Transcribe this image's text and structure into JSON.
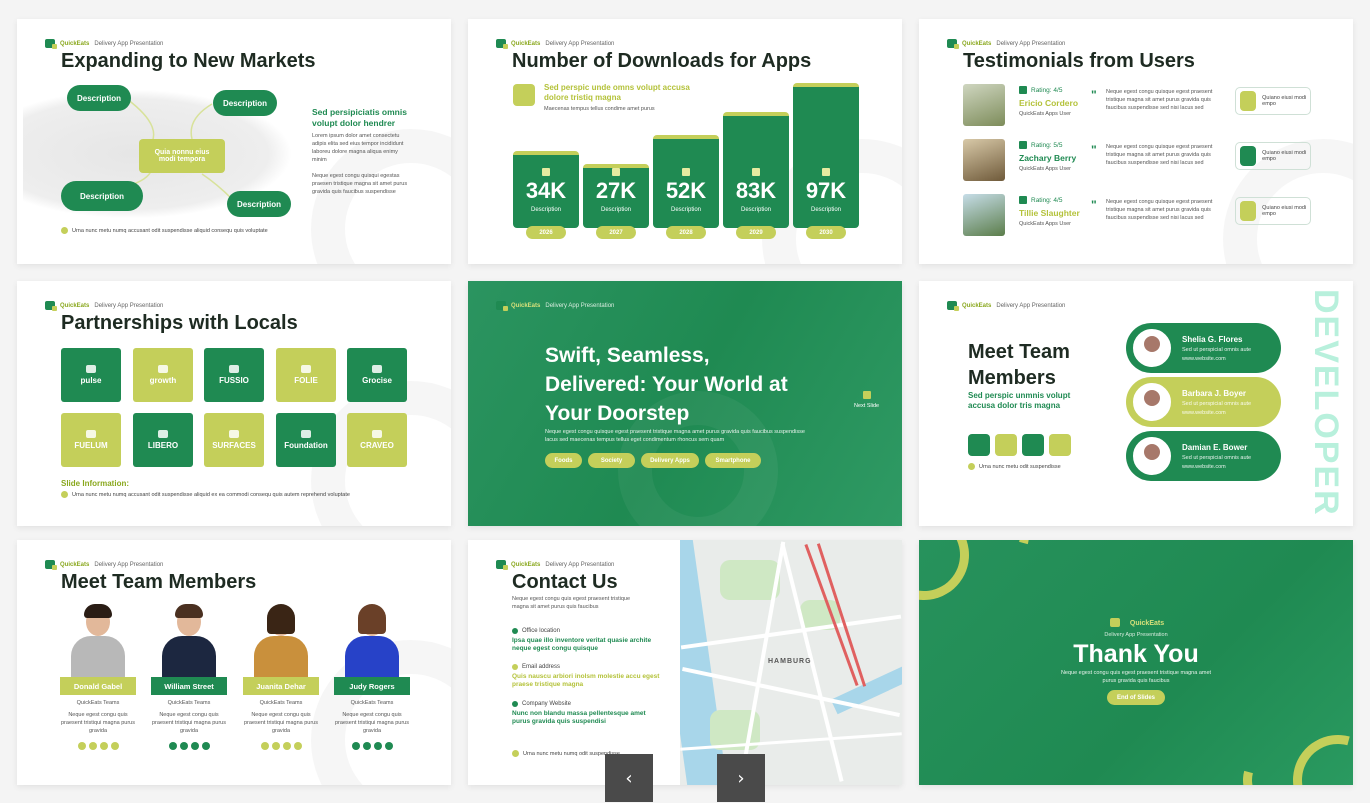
{
  "brand": {
    "name": "QuickEats",
    "subtitle": "Delivery App Presentation"
  },
  "slide1": {
    "title": "Expanding to New Markets",
    "pills": [
      "Description",
      "Description",
      "Quia nonnu eius modi tempora",
      "Description",
      "Description"
    ],
    "side_heading": "Sed persipiciatis omnis volupt dolor hendrer",
    "side_text1": "Lorem ipsum dolor amet consectetu adipis elita sed eius tempor incididunt laboreu dolore magna aliqua enimy minim",
    "side_text2": "Neque egest congu quisqui egestas praesen tristique magna sit amet purus gravida quis faucibus suspendisse",
    "footer": "Urna nunc metu numq accusant odit suspendisse aliquid consequ quis voluptate"
  },
  "slide2": {
    "title": "Number of Downloads for Apps",
    "subhead": "Sed perspic unde omns volupt accusa dolore tristiq magna",
    "subtext": "Maecenas tempus tellus condime amet purus",
    "bars": [
      {
        "value": "34K",
        "label": "Description",
        "year": "2026",
        "level": 0.53
      },
      {
        "value": "27K",
        "label": "Description",
        "year": "2027",
        "level": 0.44
      },
      {
        "value": "52K",
        "label": "Description",
        "year": "2028",
        "level": 0.64
      },
      {
        "value": "83K",
        "label": "Description",
        "year": "2029",
        "level": 0.8
      },
      {
        "value": "97K",
        "label": "Description",
        "year": "2030",
        "level": 1.0
      }
    ]
  },
  "slide3": {
    "title": "Testimonials from Users",
    "users": [
      {
        "rating": "Rating: 4/5",
        "name": "Ericio Cordero",
        "role": "QuickEats Apps User",
        "quote": "Neque egest congu quisque egest praesent tristique magna sit amet purus gravida quis faucibus suspendisse sed nisi lacus sed",
        "button": "Quiano eiusi modi empo"
      },
      {
        "rating": "Rating: 5/5",
        "name": "Zachary Berry",
        "role": "QuickEats Apps User",
        "quote": "Neque egest congu quisque egest praesent tristique magna sit amet purus gravida quis faucibus suspendisse sed nisi lacus sed",
        "button": "Quiano eiusi modi empo"
      },
      {
        "rating": "Rating: 4/5",
        "name": "Tillie Slaughter",
        "role": "QuickEats Apps User",
        "quote": "Neque egest congu quisque egest praesent tristique magna sit amet purus gravida quis faucibus suspendisse sed nisi lacus sed",
        "button": "Quiano eiusi modi empo"
      }
    ]
  },
  "slide4": {
    "title": "Partnerships with Locals",
    "partners": [
      "pulse",
      "growth",
      "FUSSIO",
      "FOLIE",
      "Grocise",
      "FUELUM",
      "LIBERO",
      "SURFACES",
      "Foundation",
      "CRAVEO"
    ],
    "info_label": "Slide Information:",
    "footer": "Urna nunc metu numq accusant odit suspendisse aliquid ex ea commodi consequ quis autem reprehend voluptate"
  },
  "slide5": {
    "title": "Swift, Seamless, Delivered: Your World at Your Doorstep",
    "desc": "Neque egest congu quisque egest praesent tristique magna amet purus gravida quis faucibus suspendisse lacus sed maecenas tempus tellus eget condimentum rhoncus sem quam",
    "tags": [
      "Foods",
      "Society",
      "Delivery Apps",
      "Smartphone"
    ],
    "next": "Next Slide"
  },
  "slide6": {
    "title": "Meet Team Members",
    "subhead": "Sed perspic unmnis volupt accusa dolor tris magna",
    "footer": "Urna nunc metu odit suspendisse",
    "vertical": "DEVELOPER",
    "members": [
      {
        "name": "Shelia G. Flores",
        "sub": "Sed ut perspicial omnis aute",
        "web": "www.website.com"
      },
      {
        "name": "Barbara J. Boyer",
        "sub": "Sed ut perspicial omnis aute",
        "web": "www.website.com"
      },
      {
        "name": "Damian E. Bower",
        "sub": "Sed ut perspicial omnis aute",
        "web": "www.website.com"
      }
    ]
  },
  "slide7": {
    "title": "Meet Team Members",
    "people": [
      {
        "name": "Donald Gabel",
        "role": "QuickEats Teams",
        "desc": "Neque egest congu quis praesent tristiqui magna purus gravida"
      },
      {
        "name": "William Street",
        "role": "QuickEats Teams",
        "desc": "Neque egest congu quis praesent tristiqui magna purus gravida"
      },
      {
        "name": "Juanita Dehar",
        "role": "QuickEats Teams",
        "desc": "Neque egest congu quis praesent tristiqui magna purus gravida"
      },
      {
        "name": "Judy Rogers",
        "role": "QuickEats Teams",
        "desc": "Neque egest congu quis praesent tristiqui magna purus gravida"
      }
    ]
  },
  "slide8": {
    "title": "Contact Us",
    "intro": "Neque egest congu quis egest praesent tristique magna sit amet purus quis faucibus",
    "office_label": "Office location",
    "office_value": "Ipsa quae illo inventore veritat quasie archite neque egest congu quisque",
    "email_label": "Email address",
    "email_value": "Quis nauscu arbiori inolsm molestie accu egest praese tristique magna",
    "web_label": "Company Website",
    "web_value": "Nunc non blandu massa pellentesque amet purus gravida quis suspendisi",
    "footer": "Urna nunc metu numq odit suspendisse",
    "map_label": "HAMBURG"
  },
  "slide9": {
    "brand": "QuickEats",
    "subtitle": "Delivery App Presentation",
    "title": "Thank You",
    "desc": "Neque egest congu quis egest praesent tristique magna amet purus gravida quis faucibus",
    "button": "End of Slides"
  },
  "nav": {
    "prev": "‹",
    "next": "›"
  }
}
